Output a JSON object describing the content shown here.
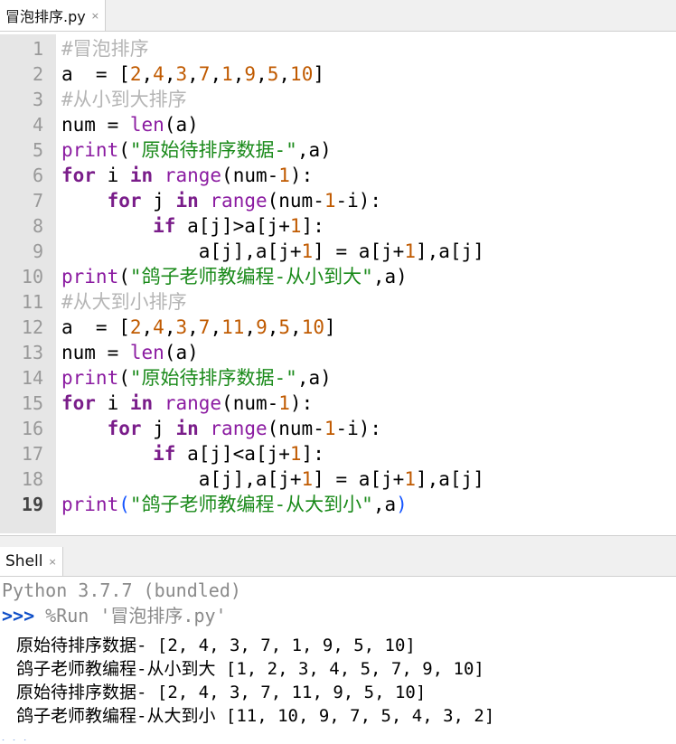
{
  "editor": {
    "tab_title": "冒泡排序.py",
    "tab_close": "×",
    "line_numbers": [
      "1",
      "2",
      "3",
      "4",
      "5",
      "6",
      "7",
      "8",
      "9",
      "10",
      "11",
      "12",
      "13",
      "14",
      "15",
      "16",
      "17",
      "18",
      "19"
    ],
    "lines": [
      [
        {
          "t": "#冒泡排序",
          "c": "comment"
        }
      ],
      [
        {
          "t": "a  = [",
          "c": "default"
        },
        {
          "t": "2",
          "c": "number"
        },
        {
          "t": ",",
          "c": "default"
        },
        {
          "t": "4",
          "c": "number"
        },
        {
          "t": ",",
          "c": "default"
        },
        {
          "t": "3",
          "c": "number"
        },
        {
          "t": ",",
          "c": "default"
        },
        {
          "t": "7",
          "c": "number"
        },
        {
          "t": ",",
          "c": "default"
        },
        {
          "t": "1",
          "c": "number"
        },
        {
          "t": ",",
          "c": "default"
        },
        {
          "t": "9",
          "c": "number"
        },
        {
          "t": ",",
          "c": "default"
        },
        {
          "t": "5",
          "c": "number"
        },
        {
          "t": ",",
          "c": "default"
        },
        {
          "t": "10",
          "c": "number"
        },
        {
          "t": "]",
          "c": "default"
        }
      ],
      [
        {
          "t": "#从小到大排序",
          "c": "comment"
        }
      ],
      [
        {
          "t": "num = ",
          "c": "default"
        },
        {
          "t": "len",
          "c": "builtin"
        },
        {
          "t": "(a)",
          "c": "default"
        }
      ],
      [
        {
          "t": "print",
          "c": "builtin"
        },
        {
          "t": "(",
          "c": "default"
        },
        {
          "t": "\"原始待排序数据-\"",
          "c": "string"
        },
        {
          "t": ",a)",
          "c": "default"
        }
      ],
      [
        {
          "t": "for",
          "c": "keyword"
        },
        {
          "t": " i ",
          "c": "default"
        },
        {
          "t": "in",
          "c": "keyword"
        },
        {
          "t": " ",
          "c": "default"
        },
        {
          "t": "range",
          "c": "builtin"
        },
        {
          "t": "(num-",
          "c": "default"
        },
        {
          "t": "1",
          "c": "number"
        },
        {
          "t": "):",
          "c": "default"
        }
      ],
      [
        {
          "t": "    ",
          "c": "default"
        },
        {
          "t": "for",
          "c": "keyword"
        },
        {
          "t": " j ",
          "c": "default"
        },
        {
          "t": "in",
          "c": "keyword"
        },
        {
          "t": " ",
          "c": "default"
        },
        {
          "t": "range",
          "c": "builtin"
        },
        {
          "t": "(num-",
          "c": "default"
        },
        {
          "t": "1",
          "c": "number"
        },
        {
          "t": "-i):",
          "c": "default"
        }
      ],
      [
        {
          "t": "        ",
          "c": "default"
        },
        {
          "t": "if",
          "c": "keyword"
        },
        {
          "t": " a[j]>a[j+",
          "c": "default"
        },
        {
          "t": "1",
          "c": "number"
        },
        {
          "t": "]:",
          "c": "default"
        }
      ],
      [
        {
          "t": "            a[j],a[j+",
          "c": "default"
        },
        {
          "t": "1",
          "c": "number"
        },
        {
          "t": "] = a[j+",
          "c": "default"
        },
        {
          "t": "1",
          "c": "number"
        },
        {
          "t": "],a[j]",
          "c": "default"
        }
      ],
      [
        {
          "t": "print",
          "c": "builtin"
        },
        {
          "t": "(",
          "c": "default"
        },
        {
          "t": "\"鸽子老师教编程-从小到大\"",
          "c": "string"
        },
        {
          "t": ",a)",
          "c": "default"
        }
      ],
      [
        {
          "t": "#从大到小排序",
          "c": "comment"
        }
      ],
      [
        {
          "t": "a  = [",
          "c": "default"
        },
        {
          "t": "2",
          "c": "number"
        },
        {
          "t": ",",
          "c": "default"
        },
        {
          "t": "4",
          "c": "number"
        },
        {
          "t": ",",
          "c": "default"
        },
        {
          "t": "3",
          "c": "number"
        },
        {
          "t": ",",
          "c": "default"
        },
        {
          "t": "7",
          "c": "number"
        },
        {
          "t": ",",
          "c": "default"
        },
        {
          "t": "11",
          "c": "number"
        },
        {
          "t": ",",
          "c": "default"
        },
        {
          "t": "9",
          "c": "number"
        },
        {
          "t": ",",
          "c": "default"
        },
        {
          "t": "5",
          "c": "number"
        },
        {
          "t": ",",
          "c": "default"
        },
        {
          "t": "10",
          "c": "number"
        },
        {
          "t": "]",
          "c": "default"
        }
      ],
      [
        {
          "t": "num = ",
          "c": "default"
        },
        {
          "t": "len",
          "c": "builtin"
        },
        {
          "t": "(a)",
          "c": "default"
        }
      ],
      [
        {
          "t": "print",
          "c": "builtin"
        },
        {
          "t": "(",
          "c": "default"
        },
        {
          "t": "\"原始待排序数据-\"",
          "c": "string"
        },
        {
          "t": ",a)",
          "c": "default"
        }
      ],
      [
        {
          "t": "for",
          "c": "keyword"
        },
        {
          "t": " i ",
          "c": "default"
        },
        {
          "t": "in",
          "c": "keyword"
        },
        {
          "t": " ",
          "c": "default"
        },
        {
          "t": "range",
          "c": "builtin"
        },
        {
          "t": "(num-",
          "c": "default"
        },
        {
          "t": "1",
          "c": "number"
        },
        {
          "t": "):",
          "c": "default"
        }
      ],
      [
        {
          "t": "    ",
          "c": "default"
        },
        {
          "t": "for",
          "c": "keyword"
        },
        {
          "t": " j ",
          "c": "default"
        },
        {
          "t": "in",
          "c": "keyword"
        },
        {
          "t": " ",
          "c": "default"
        },
        {
          "t": "range",
          "c": "builtin"
        },
        {
          "t": "(num-",
          "c": "default"
        },
        {
          "t": "1",
          "c": "number"
        },
        {
          "t": "-i):",
          "c": "default"
        }
      ],
      [
        {
          "t": "        ",
          "c": "default"
        },
        {
          "t": "if",
          "c": "keyword"
        },
        {
          "t": " a[j]<a[j+",
          "c": "default"
        },
        {
          "t": "1",
          "c": "number"
        },
        {
          "t": "]:",
          "c": "default"
        }
      ],
      [
        {
          "t": "            a[j],a[j+",
          "c": "default"
        },
        {
          "t": "1",
          "c": "number"
        },
        {
          "t": "] = a[j+",
          "c": "default"
        },
        {
          "t": "1",
          "c": "number"
        },
        {
          "t": "],a[j]",
          "c": "default"
        }
      ],
      [
        {
          "t": "print",
          "c": "builtin"
        },
        {
          "t": "(",
          "c": "paren-hl"
        },
        {
          "t": "\"鸽子老师教编程-从大到小\"",
          "c": "string"
        },
        {
          "t": ",a",
          "c": "default"
        },
        {
          "t": ")",
          "c": "paren-hl"
        }
      ]
    ],
    "current_line": "19"
  },
  "shell": {
    "tab_title": "Shell",
    "tab_close": "×",
    "banner": "Python 3.7.7 (bundled)",
    "prompt": ">>>",
    "command": " %Run '冒泡排序.py'",
    "output": [
      "原始待排序数据- [2, 4, 3, 7, 1, 9, 5, 10]",
      "鸽子老师教编程-从小到大 [1, 2, 3, 4, 5, 7, 9, 10]",
      "原始待排序数据- [2, 4, 3, 7, 11, 9, 5, 10]",
      "鸽子老师教编程-从大到小 [11, 10, 9, 7, 5, 4, 3, 2]"
    ],
    "next_prompt": ">>>"
  },
  "colors": {
    "comment": "#b5b5b5",
    "keyword": "#7a1d8a",
    "builtin": "#8b1ba1",
    "string": "#1a8a1a",
    "number": "#c05a00",
    "prompt": "#0f4fc8",
    "gutter": "#e6e6e6"
  }
}
